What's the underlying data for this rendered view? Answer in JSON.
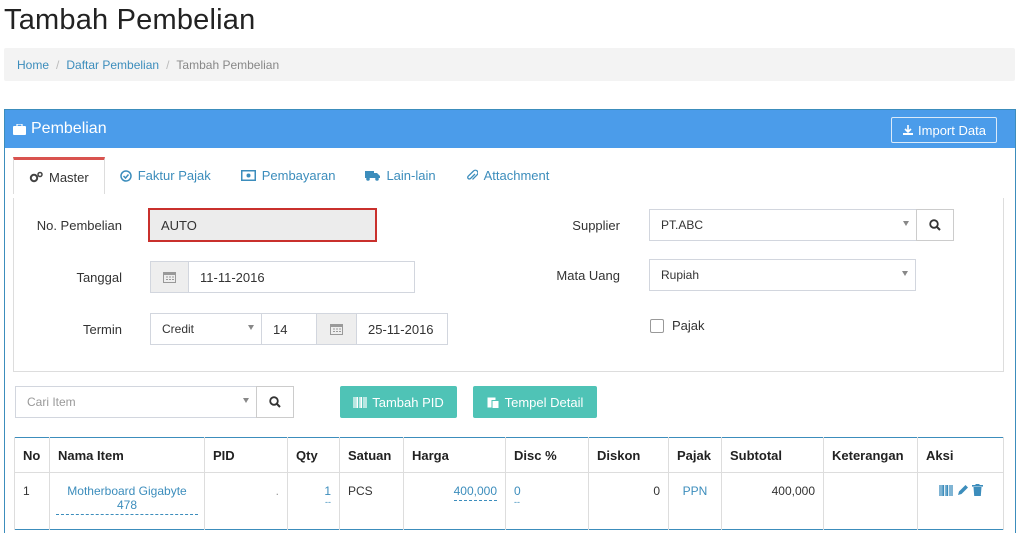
{
  "page_title": "Tambah Pembelian",
  "breadcrumb": {
    "home": "Home",
    "list": "Daftar Pembelian",
    "current": "Tambah Pembelian"
  },
  "panel": {
    "title": "Pembelian",
    "import_label": "Import Data"
  },
  "tabs": [
    {
      "label": "Master",
      "icon": "cogs-icon"
    },
    {
      "label": "Faktur Pajak",
      "icon": "check-circle-icon"
    },
    {
      "label": "Pembayaran",
      "icon": "money-icon"
    },
    {
      "label": "Lain-lain",
      "icon": "truck-icon"
    },
    {
      "label": "Attachment",
      "icon": "paperclip-icon"
    }
  ],
  "form": {
    "no_pembelian_label": "No. Pembelian",
    "no_pembelian_value": "AUTO",
    "tanggal_label": "Tanggal",
    "tanggal_value": "11-11-2016",
    "termin_label": "Termin",
    "termin_type": "Credit",
    "termin_days": "14",
    "termin_date": "25-11-2016",
    "supplier_label": "Supplier",
    "supplier_value": "PT.ABC",
    "mata_uang_label": "Mata Uang",
    "mata_uang_value": "Rupiah",
    "pajak_label": "Pajak"
  },
  "item_search": {
    "placeholder": "Cari Item"
  },
  "buttons": {
    "tambah_pid": "Tambah PID",
    "tempel_detail": "Tempel Detail"
  },
  "table": {
    "headers": [
      "No",
      "Nama Item",
      "PID",
      "Qty",
      "Satuan",
      "Harga",
      "Disc %",
      "Diskon",
      "Pajak",
      "Subtotal",
      "Keterangan",
      "Aksi"
    ],
    "rows": [
      {
        "no": "1",
        "nama_item": "Motherboard Gigabyte 478",
        "pid": ".",
        "qty": "1",
        "qty_extra": "--",
        "satuan": "PCS",
        "harga": "400,000",
        "disc": "0",
        "disc_extra": "--",
        "diskon": "0",
        "pajak": "PPN",
        "subtotal": "400,000",
        "keterangan": ""
      }
    ]
  },
  "colors": {
    "accent": "#4b9cea",
    "link": "#3c8dbc",
    "teal": "#4fc3b6",
    "danger": "#c9302c"
  }
}
